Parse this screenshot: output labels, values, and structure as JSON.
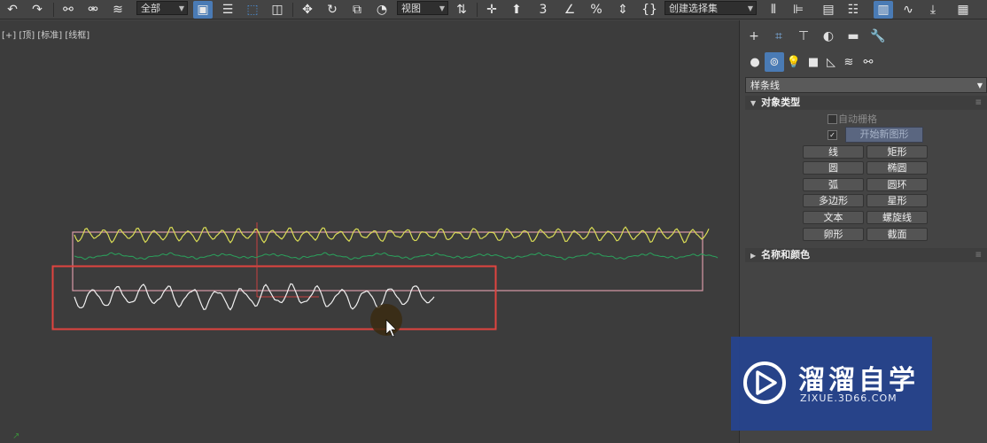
{
  "toolbar": {
    "selection_filter": "全部",
    "reference_coord": "视图",
    "named_selection_placeholder": "创建选择集"
  },
  "viewport": {
    "label": "[+] [顶] [标准] [线框]"
  },
  "command_panel": {
    "tabs": [
      "create-icon",
      "modify-icon",
      "hierarchy-icon",
      "motion-icon",
      "display-icon",
      "utilities-icon"
    ],
    "categories": [
      "geometry-icon",
      "shapes-icon",
      "lights-icon",
      "cameras-icon",
      "helpers-icon",
      "spacewarps-icon",
      "systems-icon"
    ],
    "subcategory": "样条线",
    "object_type": {
      "title": "对象类型",
      "autogrid": "自动栅格",
      "start_new_shape": "开始新图形",
      "buttons": [
        "线",
        "矩形",
        "圆",
        "椭圆",
        "弧",
        "圆环",
        "多边形",
        "星形",
        "文本",
        "螺旋线",
        "卵形",
        "截面"
      ]
    },
    "name_color": {
      "title": "名称和颜色"
    }
  },
  "watermark": {
    "title": "溜溜自学",
    "url": "ZIXUE.3D66.COM"
  },
  "colors": {
    "yellow_spline": "#d9dc55",
    "green_spline": "#2c9a5a",
    "white_spline": "#f0f0f0",
    "selection_box": "#d89aa6",
    "highlight_box": "#e0443f"
  }
}
